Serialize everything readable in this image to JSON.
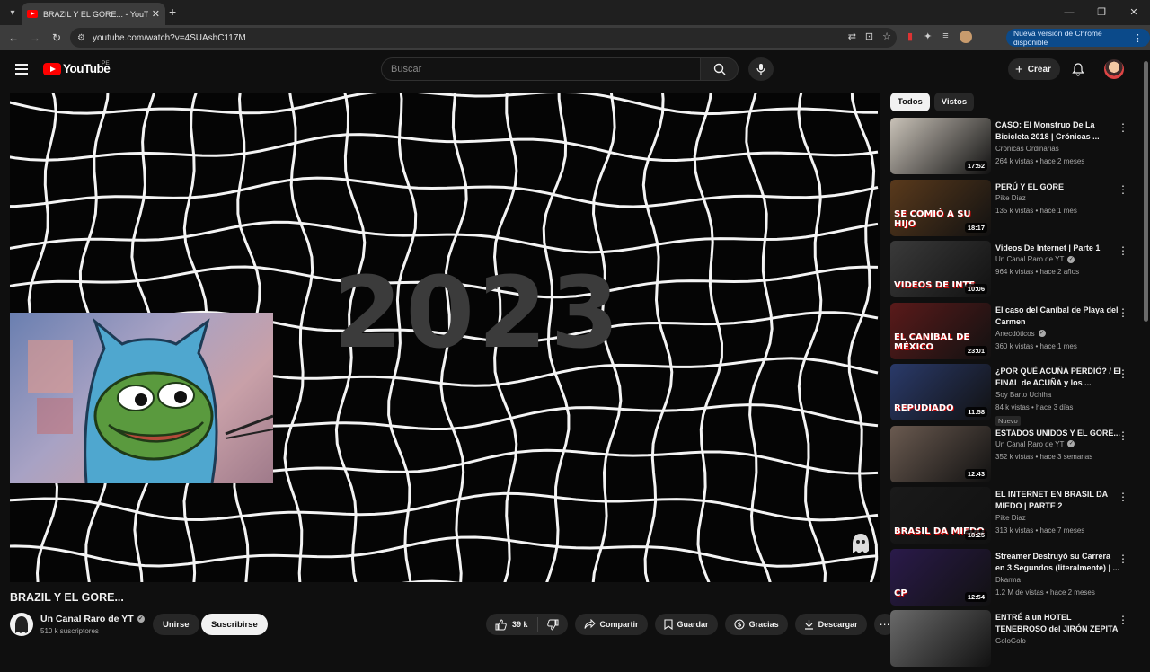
{
  "browser": {
    "tab_title": "BRAZIL Y EL GORE... - YouTube",
    "url": "youtube.com/watch?v=4SUAshC117M",
    "update_label": "Nueva versión de Chrome disponible",
    "new_tab": "+",
    "minimize": "—",
    "restore": "❐",
    "close": "✕"
  },
  "header": {
    "logo_text": "YouTube",
    "region": "PE",
    "search_placeholder": "Buscar",
    "create_label": "Crear"
  },
  "player": {
    "overlay_year": "2023"
  },
  "video": {
    "title": "BRAZIL Y EL GORE...",
    "channel": "Un Canal Raro de YT",
    "subscribers": "510 k suscriptores",
    "join_label": "Unirse",
    "subscribe_label": "Suscribirse",
    "likes": "39 k",
    "share_label": "Compartir",
    "save_label": "Guardar",
    "thanks_label": "Gracias",
    "download_label": "Descargar"
  },
  "sidebar": {
    "chips": [
      "Todos",
      "Vistos"
    ],
    "recommendations": [
      {
        "title": "CASO: El Monstruo De La Bicicleta 2018 | Crónicas ...",
        "channel": "Crónicas Ordinarias",
        "verified": false,
        "meta": "264 k vistas • hace 2 meses",
        "duration": "17:52",
        "badge": "",
        "thumb_color": "#c9c2b8"
      },
      {
        "title": "PERÚ Y EL GORE",
        "channel": "Pike Diaz",
        "verified": false,
        "meta": "135 k vistas • hace 1 mes",
        "duration": "18:17",
        "badge": "",
        "thumb_color": "#5a3a1c",
        "thumb_text": "SE COMIÓ A SU HIJO"
      },
      {
        "title": "Videos De Internet | Parte 1",
        "channel": "Un Canal Raro de YT",
        "verified": true,
        "meta": "964 k vistas • hace 2 años",
        "duration": "10:06",
        "badge": "",
        "thumb_color": "#3a3a3a",
        "thumb_text": "VIDEOS DE INTE"
      },
      {
        "title": "El caso del Caníbal de Playa del Carmen",
        "channel": "Anecdóticos",
        "verified": true,
        "meta": "360 k vistas • hace 1 mes",
        "duration": "23:01",
        "badge": "",
        "thumb_color": "#5a1a1a",
        "thumb_text": "EL CANÍBAL DE MÉXICO"
      },
      {
        "title": "¿POR QUÉ ACUÑA PERDIÓ? / El FINAL de ACUÑA y los ...",
        "channel": "Soy Barto Uchiha",
        "verified": false,
        "meta": "84 k vistas • hace 3 días",
        "duration": "11:58",
        "badge": "Nuevo",
        "thumb_color": "#2a3a6a",
        "thumb_text": "REPUDIADO"
      },
      {
        "title": "ESTADOS UNIDOS Y EL GORE...",
        "channel": "Un Canal Raro de YT",
        "verified": true,
        "meta": "352 k vistas • hace 3 semanas",
        "duration": "12:43",
        "badge": "",
        "thumb_color": "#6a5a50"
      },
      {
        "title": "EL INTERNET EN BRASIL DA MIEDO | PARTE 2",
        "channel": "Pike Diaz",
        "verified": false,
        "meta": "313 k vistas • hace 7 meses",
        "duration": "18:25",
        "badge": "",
        "thumb_color": "#1a1a1a",
        "thumb_text": "BRASIL DA MIEDO"
      },
      {
        "title": "Streamer Destruyó su Carrera en 3 Segundos (literalmente) | ...",
        "channel": "Dkarma",
        "verified": false,
        "meta": "1.2 M de vistas • hace 2 meses",
        "duration": "12:54",
        "badge": "",
        "thumb_color": "#2a1a4a",
        "thumb_text": "CP"
      },
      {
        "title": "ENTRÉ a un HOTEL TENEBROSO del JIRÓN ZEPITA",
        "channel": "GoloGolo",
        "verified": false,
        "meta": "",
        "duration": "",
        "badge": "",
        "thumb_color": "#6a6a6a"
      }
    ]
  }
}
